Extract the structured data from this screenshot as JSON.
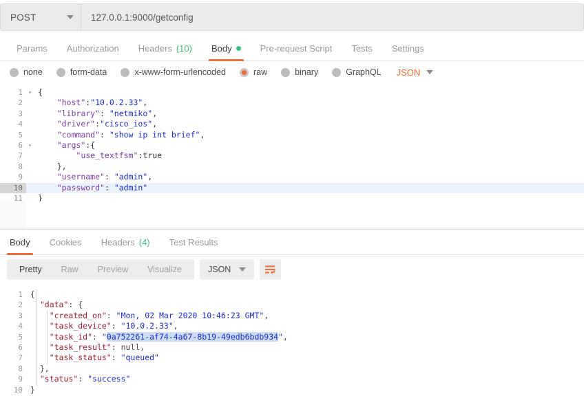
{
  "request": {
    "method": "POST",
    "url": "127.0.0.1:9000/getconfig",
    "tabs": [
      {
        "label": "Params",
        "active": false
      },
      {
        "label": "Authorization",
        "active": false
      },
      {
        "label": "Headers",
        "count": "(10)",
        "active": false
      },
      {
        "label": "Body",
        "active": true,
        "dot": true
      },
      {
        "label": "Pre-request Script",
        "active": false
      },
      {
        "label": "Tests",
        "active": false
      },
      {
        "label": "Settings",
        "active": false
      }
    ],
    "body_types": [
      {
        "label": "none",
        "selected": false
      },
      {
        "label": "form-data",
        "selected": false
      },
      {
        "label": "x-www-form-urlencoded",
        "selected": false
      },
      {
        "label": "raw",
        "selected": true
      },
      {
        "label": "binary",
        "selected": false
      },
      {
        "label": "GraphQL",
        "selected": false
      }
    ],
    "format": "JSON",
    "body_lines": [
      {
        "n": "1",
        "fold": "▾",
        "hl": false,
        "tokens": [
          {
            "t": "{",
            "c": "r-punc"
          }
        ]
      },
      {
        "n": "2",
        "fold": "",
        "hl": false,
        "tokens": [
          {
            "t": "    ",
            "c": "r-punc"
          },
          {
            "t": "\"host\"",
            "c": "r-key"
          },
          {
            "t": ":",
            "c": "r-punc"
          },
          {
            "t": "\"10.0.2.33\"",
            "c": "r-str"
          },
          {
            "t": ",",
            "c": "r-punc"
          }
        ]
      },
      {
        "n": "3",
        "fold": "",
        "hl": false,
        "tokens": [
          {
            "t": "    ",
            "c": "r-punc"
          },
          {
            "t": "\"library\"",
            "c": "r-key"
          },
          {
            "t": ": ",
            "c": "r-punc"
          },
          {
            "t": "\"netmiko\"",
            "c": "r-str"
          },
          {
            "t": ",",
            "c": "r-punc"
          }
        ]
      },
      {
        "n": "4",
        "fold": "",
        "hl": false,
        "tokens": [
          {
            "t": "    ",
            "c": "r-punc"
          },
          {
            "t": "\"driver\"",
            "c": "r-key"
          },
          {
            "t": ":",
            "c": "r-punc"
          },
          {
            "t": "\"cisco_ios\"",
            "c": "r-str"
          },
          {
            "t": ",",
            "c": "r-punc"
          }
        ]
      },
      {
        "n": "5",
        "fold": "",
        "hl": false,
        "tokens": [
          {
            "t": "    ",
            "c": "r-punc"
          },
          {
            "t": "\"command\"",
            "c": "r-key"
          },
          {
            "t": ": ",
            "c": "r-punc"
          },
          {
            "t": "\"show ip int brief\"",
            "c": "r-str"
          },
          {
            "t": ",",
            "c": "r-punc"
          }
        ]
      },
      {
        "n": "6",
        "fold": "▾",
        "hl": false,
        "tokens": [
          {
            "t": "    ",
            "c": "r-punc"
          },
          {
            "t": "\"args\"",
            "c": "r-key"
          },
          {
            "t": ":{",
            "c": "r-punc"
          }
        ]
      },
      {
        "n": "7",
        "fold": "",
        "hl": false,
        "tokens": [
          {
            "t": "        ",
            "c": "r-punc"
          },
          {
            "t": "\"use_textfsm\"",
            "c": "r-key"
          },
          {
            "t": ":",
            "c": "r-punc"
          },
          {
            "t": "true",
            "c": "r-bool"
          }
        ]
      },
      {
        "n": "8",
        "fold": "",
        "hl": false,
        "tokens": [
          {
            "t": "    },",
            "c": "r-punc"
          }
        ]
      },
      {
        "n": "9",
        "fold": "",
        "hl": false,
        "tokens": [
          {
            "t": "    ",
            "c": "r-punc"
          },
          {
            "t": "\"username\"",
            "c": "r-key"
          },
          {
            "t": ": ",
            "c": "r-punc"
          },
          {
            "t": "\"admin\"",
            "c": "r-str"
          },
          {
            "t": ",",
            "c": "r-punc"
          }
        ]
      },
      {
        "n": "10",
        "fold": "",
        "hl": true,
        "tokens": [
          {
            "t": "    ",
            "c": "r-punc"
          },
          {
            "t": "\"password\"",
            "c": "r-key"
          },
          {
            "t": ": ",
            "c": "r-punc"
          },
          {
            "t": "\"admin\"",
            "c": "r-str"
          }
        ]
      },
      {
        "n": "11",
        "fold": "",
        "hl": false,
        "tokens": [
          {
            "t": "}",
            "c": "r-punc"
          }
        ]
      }
    ]
  },
  "response": {
    "tabs": [
      {
        "label": "Body",
        "active": true
      },
      {
        "label": "Cookies",
        "active": false
      },
      {
        "label": "Headers",
        "count": "(4)",
        "active": false
      },
      {
        "label": "Test Results",
        "active": false
      }
    ],
    "view_modes": [
      {
        "label": "Pretty",
        "active": true
      },
      {
        "label": "Raw",
        "active": false
      },
      {
        "label": "Preview",
        "active": false
      },
      {
        "label": "Visualize",
        "active": false
      }
    ],
    "format": "JSON",
    "wrap_icon": "text-wrap-icon",
    "body_lines": [
      {
        "n": "1",
        "hl": false,
        "tokens": [
          {
            "t": "{",
            "c": "s-punc"
          }
        ]
      },
      {
        "n": "2",
        "hl": false,
        "tokens": [
          {
            "t": "  ",
            "c": "s-punc"
          },
          {
            "t": "\"data\"",
            "c": "s-key"
          },
          {
            "t": ": {",
            "c": "s-punc"
          }
        ]
      },
      {
        "n": "3",
        "hl": false,
        "tokens": [
          {
            "t": "    ",
            "c": "s-punc"
          },
          {
            "t": "\"created_on\"",
            "c": "s-key"
          },
          {
            "t": ": ",
            "c": "s-punc"
          },
          {
            "t": "\"Mon, 02 Mar 2020 10:46:23 GMT\"",
            "c": "s-str"
          },
          {
            "t": ",",
            "c": "s-punc"
          }
        ]
      },
      {
        "n": "4",
        "hl": false,
        "tokens": [
          {
            "t": "    ",
            "c": "s-punc"
          },
          {
            "t": "\"task_device\"",
            "c": "s-key"
          },
          {
            "t": ": ",
            "c": "s-punc"
          },
          {
            "t": "\"10.0.2.33\"",
            "c": "s-str"
          },
          {
            "t": ",",
            "c": "s-punc"
          }
        ]
      },
      {
        "n": "5",
        "hl": false,
        "tokens": [
          {
            "t": "    ",
            "c": "s-punc"
          },
          {
            "t": "\"task_id\"",
            "c": "s-key"
          },
          {
            "t": ": ",
            "c": "s-punc"
          },
          {
            "t": "\"",
            "c": "s-str"
          },
          {
            "t": "0a752261-af74-4a67-8b19-49edb6bdb934",
            "c": "s-str sel"
          },
          {
            "t": "\"",
            "c": "s-str"
          },
          {
            "t": ",",
            "c": "s-punc"
          }
        ]
      },
      {
        "n": "6",
        "hl": false,
        "tokens": [
          {
            "t": "    ",
            "c": "s-punc"
          },
          {
            "t": "\"task_result\"",
            "c": "s-key"
          },
          {
            "t": ": ",
            "c": "s-punc"
          },
          {
            "t": "null",
            "c": "s-null"
          },
          {
            "t": ",",
            "c": "s-punc"
          }
        ]
      },
      {
        "n": "7",
        "hl": false,
        "tokens": [
          {
            "t": "    ",
            "c": "s-punc"
          },
          {
            "t": "\"task_status\"",
            "c": "s-key"
          },
          {
            "t": ": ",
            "c": "s-punc"
          },
          {
            "t": "\"queued\"",
            "c": "s-str"
          }
        ]
      },
      {
        "n": "8",
        "hl": false,
        "tokens": [
          {
            "t": "  },",
            "c": "s-punc"
          }
        ]
      },
      {
        "n": "9",
        "hl": false,
        "tokens": [
          {
            "t": "  ",
            "c": "s-punc"
          },
          {
            "t": "\"status\"",
            "c": "s-key"
          },
          {
            "t": ": ",
            "c": "s-punc"
          },
          {
            "t": "\"success\"",
            "c": "s-str"
          }
        ]
      },
      {
        "n": "10",
        "hl": false,
        "tokens": [
          {
            "t": "}",
            "c": "s-punc"
          }
        ]
      }
    ]
  }
}
